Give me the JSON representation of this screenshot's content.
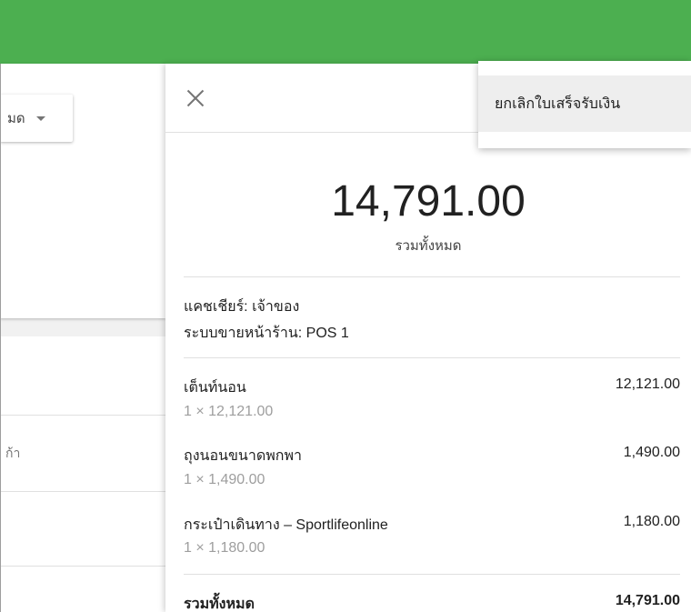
{
  "background": {
    "filter_label": "มด",
    "list_text": "ก้า"
  },
  "receipt": {
    "total": "14,791.00",
    "total_caption": "รวมทั้งหมด",
    "cashier": "แคชเชียร์: เจ้าของ",
    "pos": "ระบบขายหน้าร้าน: POS 1",
    "items": [
      {
        "name": "เต็นท์นอน",
        "qty": "1 × 12,121.00",
        "price": "12,121.00"
      },
      {
        "name": "ถุงนอนขนาดพกพา",
        "qty": "1 × 1,490.00",
        "price": "1,490.00"
      },
      {
        "name": "กระเป๋าเดินทาง – Sportlifeonline",
        "qty": "1 × 1,180.00",
        "price": "1,180.00"
      }
    ],
    "total_label": "รวมทั้งหมด",
    "total_value": "14,791.00"
  },
  "menu": {
    "cancel_receipt": "ยกเลิกใบเสร็จรับเงิน"
  },
  "colors": {
    "topbar": "#4caf50",
    "text_primary": "#212121",
    "text_secondary": "#9e9e9e"
  },
  "icons": {
    "close": "close-icon",
    "dropdown": "caret-down-icon"
  }
}
